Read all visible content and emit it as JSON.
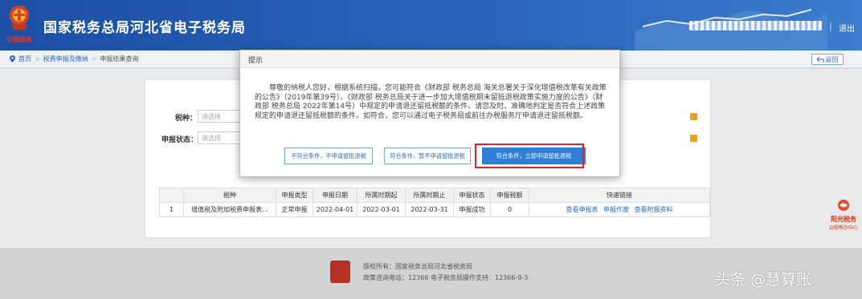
{
  "header": {
    "title": "国家税务总局河北省电子税务局",
    "sub_mark": "中国税务",
    "separator": "|",
    "logout": "退出"
  },
  "breadcrumb": {
    "home": "首页",
    "sep1": ">",
    "level1": "税费申报及缴纳",
    "sep2": ">",
    "current": "申报结果查询",
    "back_label": "返回"
  },
  "form": {
    "tax_type_label": "税种：",
    "tax_type_placeholder": "请选择",
    "status_label": "申报状态：",
    "status_placeholder": "请选择"
  },
  "table": {
    "headers": [
      "",
      "税种",
      "申报类型",
      "申报日期",
      "所属时期起",
      "所属时期止",
      "申报状态",
      "申报税额",
      "快速链接"
    ],
    "rows": [
      {
        "index": "1",
        "tax_type": "增值税及附加税费申报表...",
        "declare_type": "正常申报",
        "declare_date": "2022-04-01",
        "period_start": "2022-03-01",
        "period_end": "2022-03-31",
        "status": "申报成功",
        "amount": "0",
        "links": [
          "查看申报表",
          "申报作废",
          "查看附报资料"
        ]
      }
    ]
  },
  "side_logo": {
    "line1": "阳光税务",
    "line2": "远程帮办中心"
  },
  "footer": {
    "line1": "版权所有：国家税务总局河北省税务局",
    "line2": "政策咨询电话：12366    电子税务局操作支持：12366-9-3",
    "watermark": "头条 @慧算账"
  },
  "modal": {
    "title": "提示",
    "body": "尊敬的纳税人您好，根据系统扫描，您可能符合《财政部 税务总局 海关总署关于深化增值税改革有关政策的公告》（2019年第39号）、《财政部 税务总局关于进一步加大增值税期末留抵退税政策实施力度的公告》（财政部 税务总局 2022年第14号）中规定的申请退还留抵税额的条件。请您及时、准确地判定是否符合上述政策规定的申请退还留抵税额的条件。如符合，您可以通过电子税务局或前往办税服务厅申请退还留抵税额。",
    "btn_no": "不符合条件，不申请留抵退税",
    "btn_later": "符合条件，暂不申请留抵退税",
    "btn_apply": "符合条件，立即申请留抵退税"
  },
  "colors": {
    "header_blue": "#1b4fa3",
    "link_blue": "#2f69c2",
    "primary_button": "#2f7fd6",
    "highlight_red": "#e0222a"
  }
}
